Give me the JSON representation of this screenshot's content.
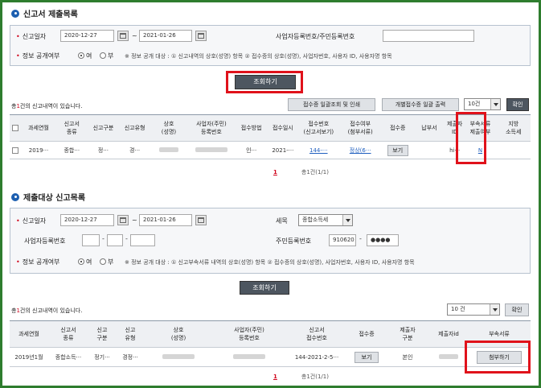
{
  "section1": {
    "title": "신고서 제출목록",
    "search": {
      "period_label": "신고일자",
      "date_from": "2020-12-27",
      "date_sep": "~",
      "date_to": "2021-01-26",
      "bizno_label": "사업자등록번호/주민등록번호",
      "bizno_value": "",
      "disclose_label": "정보 공개여부",
      "radio_yes": "여",
      "radio_no": "부",
      "notice": "※ 정보 공개 대상 : ① 신고내역의 상호(성명) 항목 ② 접수증의 상호(성명), 사업자번호, 사용자 ID, 사용자명 항목",
      "search_button": "조회하기"
    },
    "count_prefix": "총",
    "count_value": "1",
    "count_suffix": "건의 신고내역이 있습니다.",
    "btn_bulk_print": "접수증 일괄조회 및 인쇄",
    "btn_individual_print": "개별접수증 일괄 출력",
    "page_size": "10건",
    "confirm_button": "확인",
    "columns": [
      "과세연월",
      "신고서\n종류",
      "신고구분",
      "신고유형",
      "상호\n(성명)",
      "사업자(주민)\n등록번호",
      "접수방법",
      "접수일시",
      "접수번호\n(신고서보기)",
      "접수여부\n(첨부서류)",
      "접수증",
      "납부서",
      "제출자\nID",
      "부속서류\n제출여부",
      "지방\n소득세"
    ],
    "row": {
      "period": "2019···",
      "type": "종합···",
      "division": "정···",
      "kind": "경···",
      "method": "인···",
      "datetime": "2021-···",
      "receipt_no": "144-···",
      "status": "정상(6···",
      "receipt_button": "보기",
      "submitter": "hi···",
      "attach": "N"
    },
    "pager_current": "1",
    "pager_total": "총1건(1/1)"
  },
  "section2": {
    "title": "제출대상 신고목록",
    "search": {
      "period_label": "신고일자",
      "date_from": "2020-12-27",
      "date_sep": "~",
      "date_to": "2021-01-26",
      "tax_label": "세목",
      "tax_value": "종합소득세",
      "bizno_label": "사업자등록번호",
      "bizno_sep": "-",
      "rrn_label": "주민등록번호",
      "rrn_front": "910620",
      "rrn_sep": "-",
      "rrn_back": "●●●●",
      "disclose_label": "정보 공개여부",
      "radio_yes": "여",
      "radio_no": "부",
      "notice": "※ 정보 공개 대상 : ① 신고부속서류 내역의 상호(성명) 항목 ② 접수증의 상호(성명), 사업자번호, 사용자 ID, 사용자명 항목",
      "search_button": "조회하기"
    },
    "count_prefix": "총",
    "count_value": "1",
    "count_suffix": "건의 신고내역이 있습니다.",
    "page_size": "10 건",
    "confirm_button": "확인",
    "columns": [
      "과세연월",
      "신고서\n종류",
      "신고\n구분",
      "신고\n유형",
      "상호\n(성명)",
      "사업자(주민)\n등록번호",
      "신고서\n접수번호",
      "접수증",
      "제출자\n구분",
      "제출자id",
      "부속서류"
    ],
    "row": {
      "period": "2019년1월",
      "type": "종합소득···",
      "division": "정기···",
      "kind": "경정···",
      "receipt_no": "144-2021-2-5···",
      "receipt_button": "보기",
      "submitter_type": "본인",
      "attach_button": "첨부하기"
    },
    "pager_current": "1",
    "pager_total": "총1건(1/1)"
  }
}
